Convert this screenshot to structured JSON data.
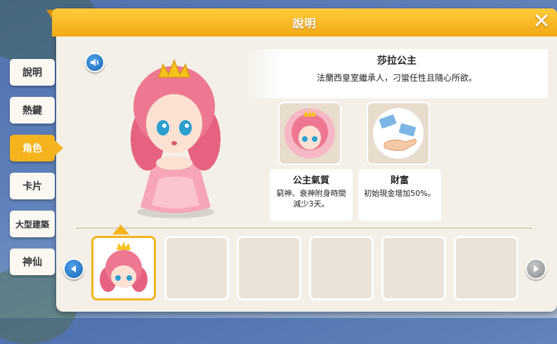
{
  "header": {
    "title": "說明"
  },
  "tabs": [
    {
      "label": "說明",
      "active": false
    },
    {
      "label": "熱鍵",
      "active": false
    },
    {
      "label": "角色",
      "active": true
    },
    {
      "label": "卡片",
      "active": false
    },
    {
      "label": "大型建築",
      "active": false
    },
    {
      "label": "神仙",
      "active": false
    }
  ],
  "character": {
    "name": "莎拉公主",
    "description": "法蘭西皇室繼承人，刁蠻任性且隨心所欲。"
  },
  "traits": [
    {
      "title": "公主氣質",
      "text": "窮神、衰神附身時間減少3天。",
      "icon": "princess-portrait-icon"
    },
    {
      "title": "財富",
      "text": "初始現金增加50%。",
      "icon": "money-hand-icon"
    }
  ],
  "icons": {
    "close": "close-icon",
    "sound": "speaker-icon",
    "prev": "arrow-left-icon",
    "next": "arrow-right-icon"
  },
  "colors": {
    "accent": "#f5b41e",
    "header": "#f2a817",
    "nav_active": "#1f67b5",
    "nav_inactive": "#8a8a8a"
  }
}
